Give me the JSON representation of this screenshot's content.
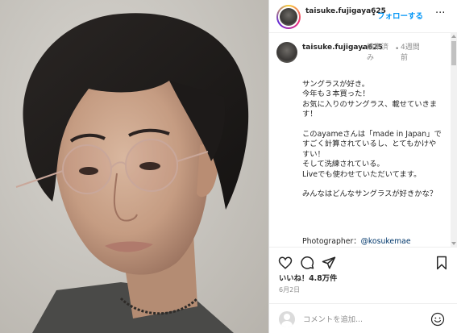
{
  "header": {
    "username": "taisuke.fujigaya625",
    "dot": "•",
    "follow_label": "フォローする",
    "more_label": "···"
  },
  "caption": {
    "username": "taisuke.fujigaya625",
    "dot": "•",
    "edited": "編集済み",
    "time": "4週間前",
    "text": "サングラスが好き。\n今年も３本買った！\nお気に入りのサングラス、載せていきます！\n\nこのayameさんは「made in Japan」ですごく計算されているし、とてもかけやすい！\nそして洗練されている。\nLiveでも使わせていただいてます。\n\nみんなはどんなサングラスが好きかな？",
    "photographer_label": "Photographer：",
    "photographer_mention": "@kosukemae"
  },
  "actions": {
    "like_icon": "heart-icon",
    "comment_icon": "comment-icon",
    "share_icon": "paper-plane-icon",
    "save_icon": "bookmark-icon"
  },
  "likes": "いいね！4.8万件",
  "date": "6月2日",
  "comment_box": {
    "placeholder": "コメントを追加...",
    "emoji_icon": "smiley-icon"
  },
  "colors": {
    "accent": "#0095f6",
    "text": "#262626",
    "muted": "#8e8e8e",
    "border": "#dbdbdb"
  }
}
